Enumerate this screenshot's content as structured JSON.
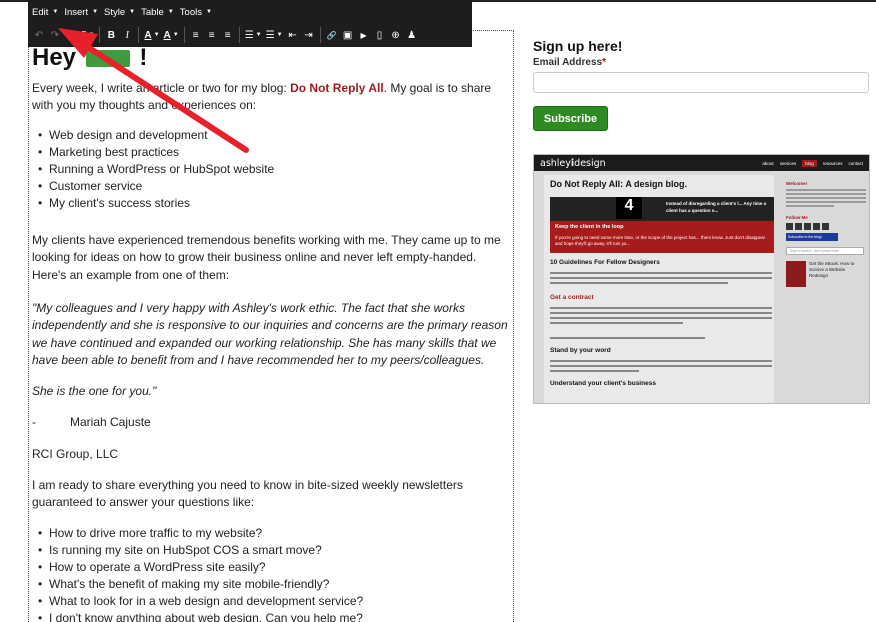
{
  "toolbar": {
    "menus": [
      "Edit",
      "Insert",
      "Style",
      "Table",
      "Tools"
    ],
    "buttons": {
      "undo": "↶",
      "redo": "↷",
      "source": "<>",
      "format": "¶",
      "bold": "B",
      "italic": "I",
      "text_color": "A",
      "bg_color": "A",
      "align_left": "≡",
      "align_center": "≡",
      "align_right": "≡",
      "bullet_list": "☰",
      "numbered_list": "☰",
      "outdent": "⇤",
      "indent": "⇥",
      "link": "🔗",
      "image": "▣",
      "video": "▶",
      "page": "▯",
      "plus": "⊕",
      "person": "♟"
    }
  },
  "content": {
    "heading": {
      "before": "Hey",
      "after": "!"
    },
    "intro": {
      "before": "Every week, I write an article or two for my blog: ",
      "brand": "Do Not Reply All",
      "after": ". My goal is to share with you my thoughts and experiences on:"
    },
    "topics": [
      "Web design and development",
      "Marketing best practices",
      "Running a WordPress or HubSpot website",
      "Customer service",
      "My client's success stories"
    ],
    "clients": "My clients have experienced tremendous benefits working with me. They came up to me looking for ideas on how to grow their business online and never left empty-handed. Here's an example from one of them:",
    "testimonial": "\"My colleagues and I very happy with Ashley's work ethic. The fact that she works independently and she is responsive to our inquiries and concerns are the primary reason we have continued and expanded our working relationship. She has many skills that we have been able to benefit from and I have recommended her to my peers/colleagues.",
    "testimonial_end": "She is the one for you.\"",
    "author_dash": "-",
    "author": "Mariah Cajuste",
    "company": "RCI Group, LLC",
    "newsletter": "I am ready to share everything you need to know in bite-sized weekly newsletters guaranteed to answer your questions like:",
    "questions": [
      "How to drive more traffic to my website?",
      "Is running my site on HubSpot COS a smart move?",
      "How to operate a WordPress site easily?",
      "What's the benefit of making my site mobile-friendly?",
      "What to look for in a web design and development service?",
      "I don't know anything about web design. Can you help me?"
    ]
  },
  "sidebar": {
    "signup_title": "Sign up here!",
    "email_label": "Email Address",
    "required_mark": "*",
    "subscribe_label": "Subscribe"
  },
  "thumbnail": {
    "logo_a": "ashley",
    "logo_b": "i",
    "logo_c": "design",
    "nav": [
      "about",
      "services",
      "blog",
      "resources",
      "contact"
    ],
    "title": "Do Not Reply All: A design blog.",
    "hero_number": "4",
    "hero_text": "Instead of disregarding a client's l... Any time a client has a question o...",
    "hero_red_heading": "Keep the client in the loop",
    "hero_red_text": "If you're going to need some more time, or the scope of the project has... them know. Just don't disappear and hope they'll go away, it'll ruin yo...",
    "post_title": "10 Guidelines For Fellow Designers",
    "section1": "Get a contract",
    "section2": "Stand by your word",
    "section3": "Understand your client's business",
    "side_welcome": "Welcome!",
    "side_follow": "Follow Me",
    "side_subscribe": "Subscribe to the blog!",
    "side_search": "Type to search, then press enter",
    "side_ebook": "Get the eBook: How to Survive a Website Redesign"
  },
  "colors": {
    "brand_red": "#9b1c1c",
    "subscribe_green": "#2f8a23",
    "arrow_red": "#e8202a",
    "toolbar_bg": "#1d1d1d"
  }
}
